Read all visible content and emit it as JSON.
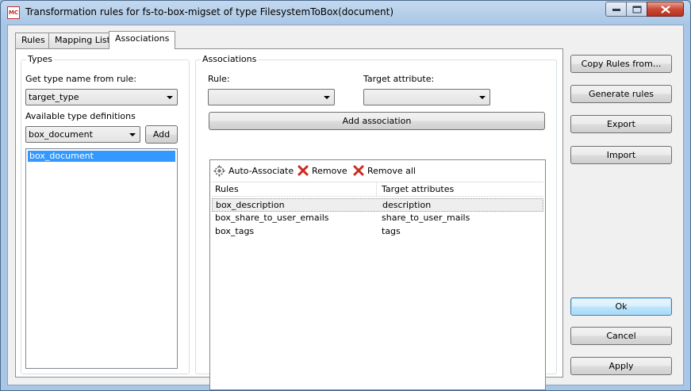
{
  "window": {
    "title": "Transformation rules for fs-to-box-migset of type FilesystemToBox(document)",
    "icon_text": "MC"
  },
  "tabs": [
    {
      "label": "Rules",
      "active": false
    },
    {
      "label": "Mapping Lists",
      "active": false
    },
    {
      "label": "Associations",
      "active": true
    }
  ],
  "types": {
    "group_title": "Types",
    "get_type_label": "Get type name from rule:",
    "get_type_value": "target_type",
    "available_label": "Available type definitions",
    "available_value": "box_document",
    "add_button": "Add",
    "list_items": [
      "box_document"
    ]
  },
  "associations": {
    "group_title": "Associations",
    "rule_label": "Rule:",
    "rule_value": "",
    "target_label": "Target attribute:",
    "target_value": "",
    "add_button": "Add association",
    "toolbar": {
      "auto_associate": "Auto-Associate",
      "remove": "Remove",
      "remove_all": "Remove all"
    },
    "columns": [
      "Rules",
      "Target attributes"
    ],
    "rows": [
      {
        "rule": "box_description",
        "target": "description",
        "selected": true
      },
      {
        "rule": "box_share_to_user_emails",
        "target": "share_to_user_mails",
        "selected": false
      },
      {
        "rule": "box_tags",
        "target": "tags",
        "selected": false
      }
    ]
  },
  "side_buttons": {
    "copy_rules": "Copy Rules from...",
    "generate_rules": "Generate rules",
    "export": "Export",
    "import": "Import",
    "ok": "Ok",
    "cancel": "Cancel",
    "apply": "Apply"
  },
  "colors": {
    "selection": "#3399ff",
    "remove_icon": "#cc2a1f",
    "default_button_border": "#3c7fb1"
  }
}
